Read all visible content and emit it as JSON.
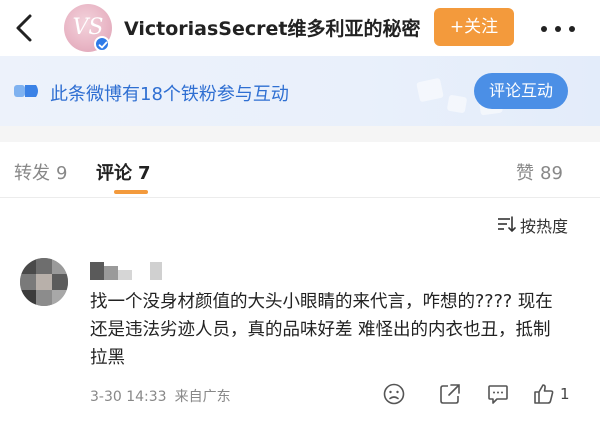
{
  "header": {
    "avatar_monogram": "VS",
    "account_name": "VictoriasSecret维多利亚的秘密",
    "follow_label": "+关注"
  },
  "banner": {
    "text": "此条微博有18个铁粉参与互动",
    "button_label": "评论互动"
  },
  "tabs": [
    {
      "label": "转发",
      "count": "9"
    },
    {
      "label": "评论",
      "count": "7",
      "active": true
    },
    {
      "label": "赞",
      "count": "89"
    }
  ],
  "sort": {
    "label": "按热度"
  },
  "comment": {
    "text": "找一个没身材颜值的大头小眼睛的来代言，咋想的????  现在还是违法劣迹人员，真的品味好差 难怪出的内衣也丑，抵制拉黑",
    "date": "3-30 14:33",
    "location": "来自广东",
    "like_count": "1",
    "avatar_pixelated": true,
    "name_pixelated": true
  },
  "colors": {
    "accent_orange": "#f39a3c",
    "link_blue": "#2f6fd2",
    "button_blue": "#4b8fe6",
    "verified_blue": "#2f7be8"
  },
  "icons": [
    "back-arrow-icon",
    "verified-badge-icon",
    "more-dots-icon",
    "fan-interaction-icon",
    "sort-icon",
    "emoji-icon",
    "share-icon",
    "comment-icon",
    "like-icon"
  ]
}
